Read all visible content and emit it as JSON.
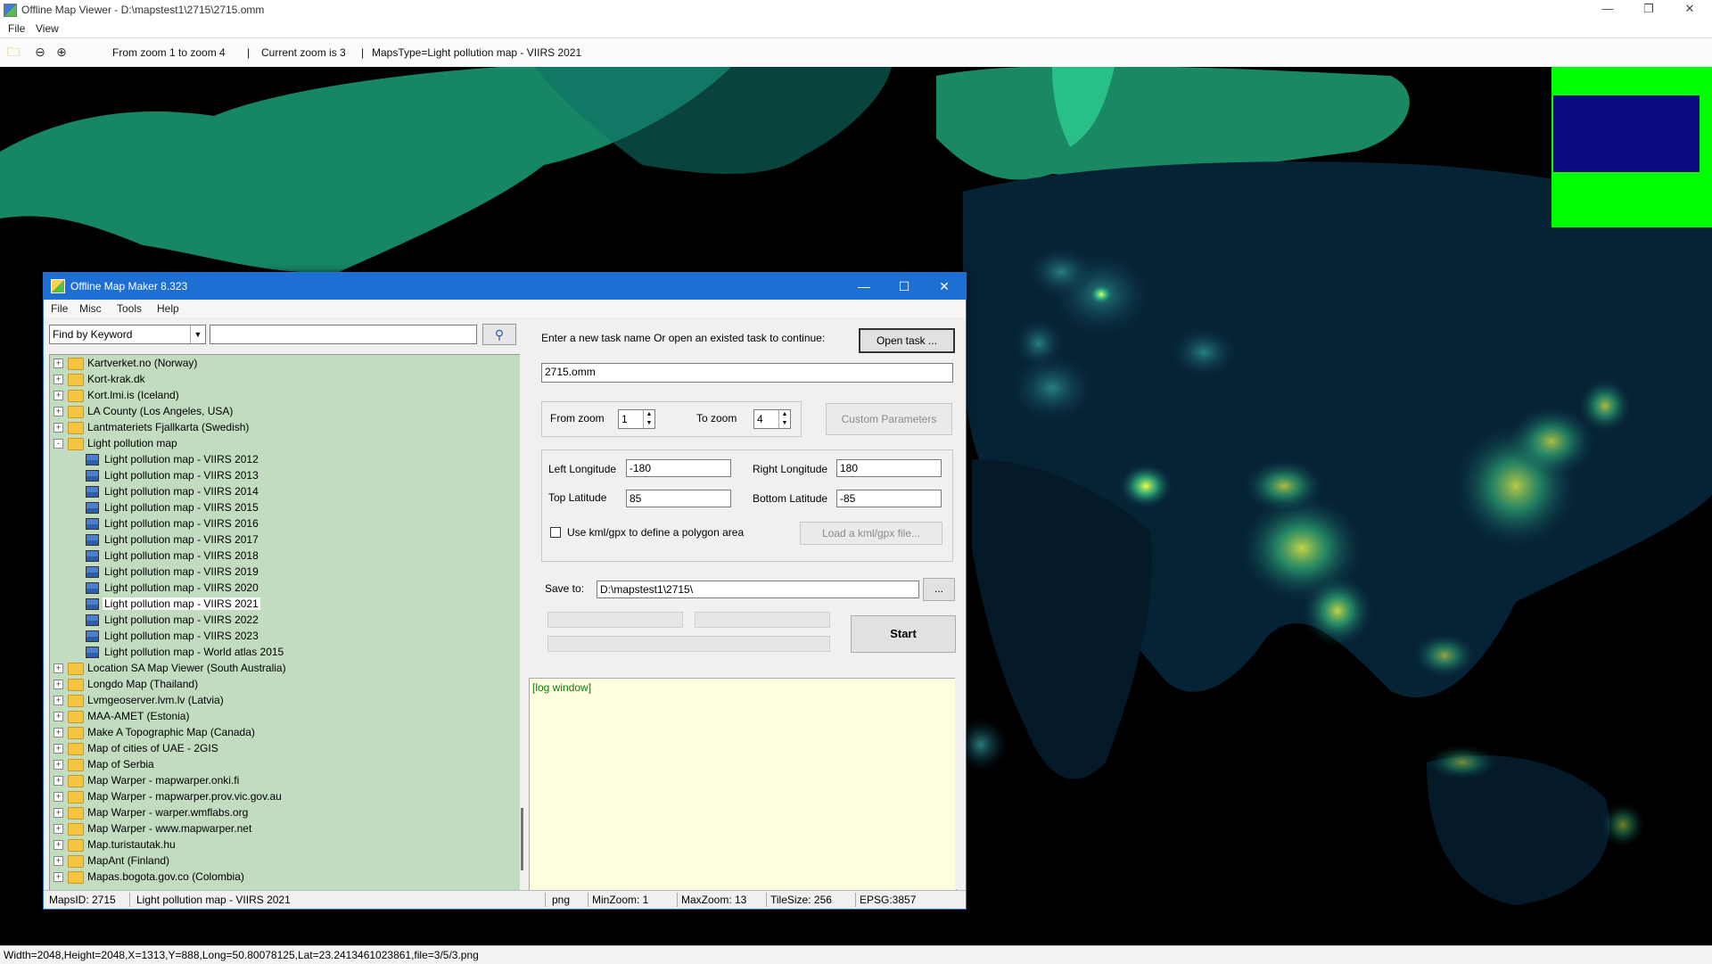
{
  "outer": {
    "title": "Offline Map Viewer - D:\\mapstest1\\2715\\2715.omm",
    "menu": [
      "File",
      "View"
    ],
    "toolbar": {
      "zoom_range": "From zoom 1 to zoom 4",
      "sep1": "|",
      "current_zoom": "Current zoom is 3",
      "sep2": "|",
      "maps_type": "MapsType=Light pollution map - VIIRS 2021"
    },
    "status": "Width=2048,Height=2048,X=1313,Y=888,Long=50.80078125,Lat=23.2413461023861,file=3/5/3.png"
  },
  "maker": {
    "title": "Offline Map Maker 8.323",
    "menu": [
      "File",
      "Misc",
      "Tools",
      "Help"
    ],
    "search_mode": "Find by Keyword",
    "tree": [
      {
        "label": "Kartverket.no (Norway)",
        "level": 0,
        "type": "folder",
        "exp": "+"
      },
      {
        "label": "Kort-krak.dk",
        "level": 0,
        "type": "folder",
        "exp": "+"
      },
      {
        "label": "Kort.lmi.is (Iceland)",
        "level": 0,
        "type": "folder",
        "exp": "+"
      },
      {
        "label": "LA County (Los Angeles, USA)",
        "level": 0,
        "type": "folder",
        "exp": "+"
      },
      {
        "label": "Lantmateriets Fjallkarta (Swedish)",
        "level": 0,
        "type": "folder",
        "exp": "+"
      },
      {
        "label": "Light pollution map",
        "level": 0,
        "type": "folder-open",
        "exp": "-"
      },
      {
        "label": "Light pollution map - VIIRS 2012",
        "level": 1,
        "type": "map"
      },
      {
        "label": "Light pollution map - VIIRS 2013",
        "level": 1,
        "type": "map"
      },
      {
        "label": "Light pollution map - VIIRS 2014",
        "level": 1,
        "type": "map"
      },
      {
        "label": "Light pollution map - VIIRS 2015",
        "level": 1,
        "type": "map"
      },
      {
        "label": "Light pollution map - VIIRS 2016",
        "level": 1,
        "type": "map"
      },
      {
        "label": "Light pollution map - VIIRS 2017",
        "level": 1,
        "type": "map"
      },
      {
        "label": "Light pollution map - VIIRS 2018",
        "level": 1,
        "type": "map"
      },
      {
        "label": "Light pollution map - VIIRS 2019",
        "level": 1,
        "type": "map"
      },
      {
        "label": "Light pollution map - VIIRS 2020",
        "level": 1,
        "type": "map"
      },
      {
        "label": "Light pollution map - VIIRS 2021",
        "level": 1,
        "type": "map",
        "selected": true
      },
      {
        "label": "Light pollution map - VIIRS 2022",
        "level": 1,
        "type": "map"
      },
      {
        "label": "Light pollution map - VIIRS 2023",
        "level": 1,
        "type": "map"
      },
      {
        "label": "Light pollution map - World atlas 2015",
        "level": 1,
        "type": "map"
      },
      {
        "label": "Location SA Map Viewer (South Australia)",
        "level": 0,
        "type": "folder",
        "exp": "+"
      },
      {
        "label": "Longdo Map (Thailand)",
        "level": 0,
        "type": "folder",
        "exp": "+"
      },
      {
        "label": "Lvmgeoserver.lvm.lv (Latvia)",
        "level": 0,
        "type": "folder",
        "exp": "+"
      },
      {
        "label": "MAA-AMET (Estonia)",
        "level": 0,
        "type": "folder",
        "exp": "+"
      },
      {
        "label": "Make A Topographic Map (Canada)",
        "level": 0,
        "type": "folder",
        "exp": "+"
      },
      {
        "label": "Map of cities of UAE - 2GIS",
        "level": 0,
        "type": "folder",
        "exp": "+"
      },
      {
        "label": "Map of Serbia",
        "level": 0,
        "type": "folder",
        "exp": "+"
      },
      {
        "label": "Map Warper - mapwarper.onki.fi",
        "level": 0,
        "type": "folder",
        "exp": "+"
      },
      {
        "label": "Map Warper - mapwarper.prov.vic.gov.au",
        "level": 0,
        "type": "folder",
        "exp": "+"
      },
      {
        "label": "Map Warper - warper.wmflabs.org",
        "level": 0,
        "type": "folder",
        "exp": "+"
      },
      {
        "label": "Map Warper - www.mapwarper.net",
        "level": 0,
        "type": "folder",
        "exp": "+"
      },
      {
        "label": "Map.turistautak.hu",
        "level": 0,
        "type": "folder",
        "exp": "+"
      },
      {
        "label": "MapAnt (Finland)",
        "level": 0,
        "type": "folder",
        "exp": "+"
      },
      {
        "label": "Mapas.bogota.gov.co (Colombia)",
        "level": 0,
        "type": "folder",
        "exp": "+"
      }
    ],
    "task_prompt": "Enter a new task name Or open an existed task to continue:",
    "open_task": "Open task ...",
    "task_name": "2715.omm",
    "from_zoom_label": "From zoom",
    "from_zoom": "1",
    "to_zoom_label": "To zoom",
    "to_zoom": "4",
    "custom_params": "Custom Parameters",
    "left_lon_label": "Left Longitude",
    "left_lon": "-180",
    "right_lon_label": "Right Longitude",
    "right_lon": "180",
    "top_lat_label": "Top Latitude",
    "top_lat": "85",
    "bottom_lat_label": "Bottom Latitude",
    "bottom_lat": "-85",
    "kml_label": "Use kml/gpx to define a polygon area",
    "load_kml": "Load a kml/gpx file...",
    "save_label": "Save to:",
    "save_path": "D:\\mapstest1\\2715\\",
    "browse": "...",
    "start": "Start",
    "log_title": "[log window]",
    "status": {
      "maps_id": "MapsID: 2715",
      "map_name": "Light pollution map - VIIRS 2021",
      "format": "png",
      "min_zoom": "MinZoom: 1",
      "max_zoom": "MaxZoom: 13",
      "tile_size": "TileSize: 256",
      "epsg": "EPSG:3857"
    }
  },
  "colors": {
    "accent": "#1e6fd4",
    "tree_bg": "#c2dcc0",
    "log_bg": "#ffffe0",
    "map_glow": "#39d98a"
  }
}
